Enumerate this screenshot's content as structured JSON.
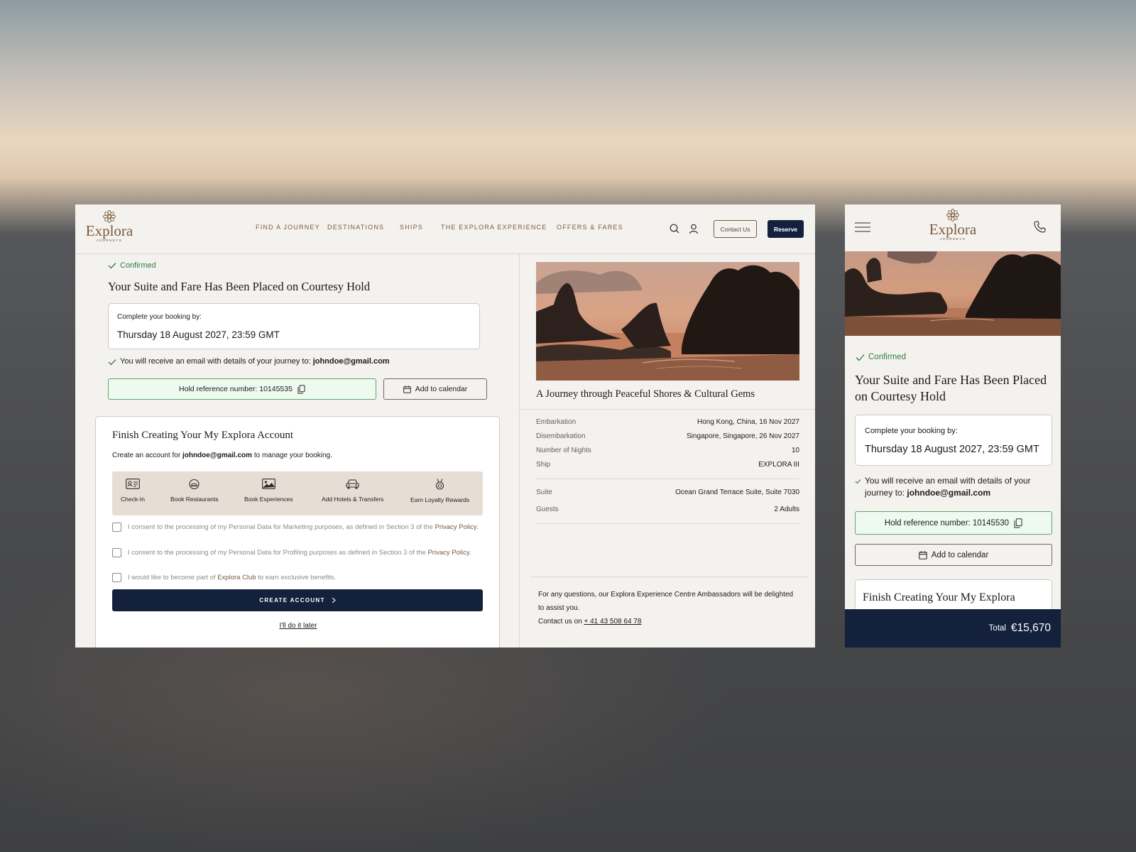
{
  "brand": {
    "name": "Explora",
    "tagline": "JOURNEYS"
  },
  "nav": {
    "items": [
      "FIND A JOURNEY",
      "DESTINATIONS",
      "SHIPS",
      "THE EXPLORA EXPERIENCE",
      "OFFERS & FARES"
    ]
  },
  "header": {
    "contact_label": "Contact Us",
    "reserve_label": "Reserve"
  },
  "status": {
    "label": "Confirmed"
  },
  "page_title": "Your Suite and Fare Has Been Placed on Courtesy Hold",
  "hold": {
    "label": "Complete your booking by:",
    "deadline": "Thursday 18 August 2027, 23:59 GMT"
  },
  "email_notice": {
    "prefix": "You will receive an email with details of your journey to:",
    "email": "johndoe@gmail.com"
  },
  "reference": {
    "desktop_label": "Hold reference number: 10145535",
    "mobile_label": "Hold reference number: 10145530"
  },
  "calendar": {
    "label": "Add to calendar"
  },
  "account": {
    "title": "Finish Creating Your My Explora Account",
    "mobile_title": "Finish Creating Your My Explora",
    "subtitle_prefix": "Create an account for",
    "subtitle_email": "johndoe@gmail.com",
    "subtitle_suffix": "to manage your booking.",
    "benefits": [
      "Check-In",
      "Book Restaurants",
      "Book Experiences",
      "Add Hotels & Transfers",
      "Earn Loyalty Rewards"
    ],
    "consents": {
      "marketing_text": "I consent to the processing of my Personal Data for Marketing purposes, as defined in Section 3 of the",
      "marketing_link": "Privacy Policy.",
      "profiling_text": "I consent to the processing of my Personal Data for Profiling purposes as defined in Section 3 of the",
      "profiling_link": "Privacy Policy.",
      "club_prefix": "I would like to become part of",
      "club_link": "Explora Club",
      "club_suffix": "to earn exclusive benefits."
    },
    "create_label": "CREATE ACCOUNT",
    "later_label": "I'll do it later"
  },
  "journey": {
    "title": "A Journey through Peaceful Shores & Cultural Gems",
    "details": [
      {
        "label": "Embarkation",
        "value": "Hong Kong, China, 16 Nov 2027"
      },
      {
        "label": "Disembarkation",
        "value": "Singapore, Singapore, 26 Nov 2027"
      },
      {
        "label": "Number of Nights",
        "value": "10"
      },
      {
        "label": "Ship",
        "value": "EXPLORA III"
      },
      {
        "label": "Suite",
        "value": "Ocean Grand Terrace Suite, Suite 7030"
      },
      {
        "label": "Guests",
        "value": "2 Adults"
      }
    ]
  },
  "help": {
    "line1": "For any questions, our Explora Experience Centre Ambassadors will be delighted to assist you.",
    "contact_prefix": "Contact us on",
    "phone": "+ 41 43 508 64 78"
  },
  "total": {
    "label": "Total",
    "value": "€15,670"
  },
  "colors": {
    "brand_gold": "#7a5a3a",
    "navy": "#13213d",
    "confirm_green": "#2f7d3f",
    "ref_bg": "#eefaef"
  },
  "icons": [
    "lotus-logo-icon",
    "search-icon",
    "user-icon",
    "check-icon",
    "copy-icon",
    "calendar-icon",
    "id-card-icon",
    "dining-cloche-icon",
    "image-icon",
    "car-icon",
    "medal-icon",
    "chevron-right-icon",
    "menu-icon",
    "phone-icon"
  ]
}
